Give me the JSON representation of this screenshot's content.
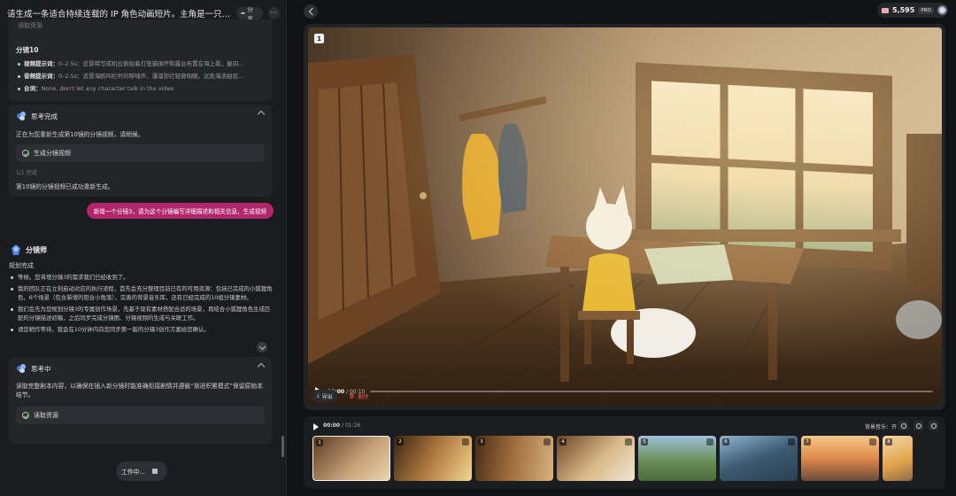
{
  "chat": {
    "title": "请生成一条适合持续连载的 IP 角色动画短片。主角是一只固定设...",
    "share_label": "分享",
    "more_label": "···",
    "top_faded": "读取资源",
    "shot10": {
      "title": "分镜10",
      "lines": [
        {
          "label": "视频提示词：",
          "text": "0–2.5s：近景特写成机位俯拍着灯笼猫围坏和露台布置在海上看，屋间..."
        },
        {
          "label": "音频提示词：",
          "text": "0–2.5s：近景海鸥叫栏杆的呼啸声，瀑溜弥烂轻微响喇，远处海浪拍惩..."
        },
        {
          "label": "台词：",
          "text": "None, don't let any character talk in the video"
        }
      ]
    },
    "thinking_done": {
      "title": "思考完成",
      "text": "正在为您重新生成第10镜的分镜视频，请稍候。",
      "tool": "生成分镜视频",
      "sub": "1/1 完成",
      "result": "第10镜的分镜视频已成功重新生成。"
    },
    "user_message": "新增一个分镜3，请为这个分镜编写详细描述和相关信息，生成视频",
    "agent": {
      "name": "分镜师",
      "status": "规划完成",
      "plan": [
        "等候。您将增分镜3的需求我们已经收到了。",
        "我的团队正在立刻启动对应的执行流程，首先会充分整理目前已有的可用资源：包括已完成的小狐狸角色、6个场景（包含新增的阳台小角落），完善的背景音乐库，还有已经完成的10组分镜素材。",
        "我们会先为您规划分镜3的专属创作场景，先基于现有素材搭配合适的场景，再结合小狐狸角色生成匹配的分镜描述初稿，之后同步完成分镜图、分镜视频的生成与关联工作。",
        "请您稍作等待，我会在10分钟内向您同步第一版的分镜3创作方案给您确认。"
      ]
    },
    "thinking_now": {
      "title": "思考中",
      "text": "读取完整剧本内容，以确保在插入新分镜时能准确衔接剧情并遵循“渐进积累模式”保留原始本结节。",
      "tool": "读取资源"
    },
    "working_label": "工作中..."
  },
  "topbar": {
    "credits": "5,595",
    "plan_badge": "PRO"
  },
  "player": {
    "shot_number": "1",
    "time_current": "00:00",
    "time_total": "/ 00:10",
    "progress": 0
  },
  "actions": {
    "export_label": "导出",
    "delete_label": "删除"
  },
  "timeline": {
    "time_current": "00:00",
    "time_total": "/ 01:26",
    "bgm_label": "背景音乐：开",
    "shots": [
      {
        "num": "1",
        "scene": "room-window"
      },
      {
        "num": "2",
        "scene": "room-sunbeam"
      },
      {
        "num": "3",
        "scene": "room-door"
      },
      {
        "num": "4",
        "scene": "fox-map"
      },
      {
        "num": "5",
        "scene": "coast-cliff"
      },
      {
        "num": "6",
        "scene": "coast-path"
      },
      {
        "num": "7",
        "scene": "lighthouse-sunset"
      },
      {
        "num": "8",
        "scene": "fox-lighthouse"
      }
    ]
  }
}
